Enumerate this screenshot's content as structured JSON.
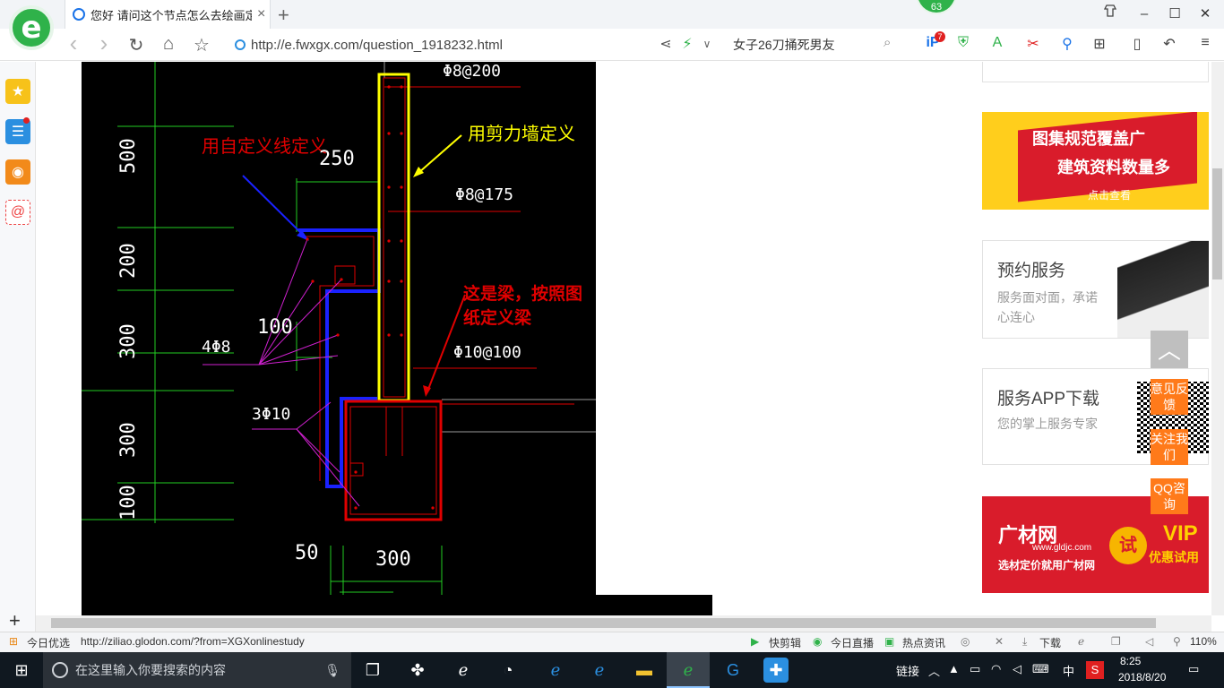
{
  "browser": {
    "tab_title": "您好 请问这个节点怎么去绘画定",
    "tab_close": "×",
    "new_tab": "+",
    "badge_count": "63",
    "url": "http://e.fwxgx.com/question_1918232.html",
    "news_query": "女子26刀捅死男友",
    "notif_count": "7",
    "window_controls": {
      "restore_label": "❐",
      "minimize": "–",
      "maximize": "☐",
      "close": "✕"
    }
  },
  "nav_icons": {
    "back": "‹",
    "forward": "›",
    "refresh": "↻",
    "home": "⌂",
    "favorite": "☆"
  },
  "cad": {
    "annotations": {
      "custom_line": "用自定义线定义",
      "shear_wall": "用剪力墙定义",
      "beam": "这是梁，按照图纸定义梁"
    },
    "rebar_labels": [
      "Φ8@200",
      "Φ8@175",
      "Φ10@100",
      "4Φ8",
      "3Φ10"
    ],
    "dimensions": [
      "500",
      "200",
      "300",
      "300",
      "100",
      "250",
      "100",
      "50",
      "300"
    ]
  },
  "right_panel": {
    "banner1": {
      "line1": "图集规范覆盖广",
      "line2": "建筑资料数量多",
      "link": "点击查看"
    },
    "service": {
      "title": "预约服务",
      "desc": "服务面对面，承诺心连心"
    },
    "app": {
      "title": "服务APP下载",
      "desc": "您的掌上服务专家"
    },
    "banner2": {
      "brand": "广材网",
      "site": "www.gldjc.com",
      "slogan": "选材定价就用广材网",
      "trial": "试",
      "vip": "VIP",
      "vip_sub": "优惠试用"
    },
    "float_buttons": [
      "意见反馈",
      "关注我们",
      "QQ咨询"
    ],
    "top_arrow": "︿"
  },
  "sidebar": {
    "add": "+"
  },
  "statusbar": {
    "left_label": "今日优选",
    "link_url": "http://ziliao.glodon.com/?from=XGXonlinestudy",
    "items": [
      "快剪辑",
      "今日直播",
      "热点资讯",
      "下载"
    ],
    "zoom": "110%"
  },
  "taskbar": {
    "search_placeholder": "在这里输入你要搜索的内容",
    "tray_link": "链接",
    "ime": "中",
    "time": "8:25",
    "date": "2018/8/20"
  },
  "colors": {
    "accent_green": "#2fb24a",
    "orange": "#ff7a1a",
    "cad_red": "#e00000",
    "cad_yellow": "#ffff00",
    "cad_blue": "#1a22ff"
  }
}
